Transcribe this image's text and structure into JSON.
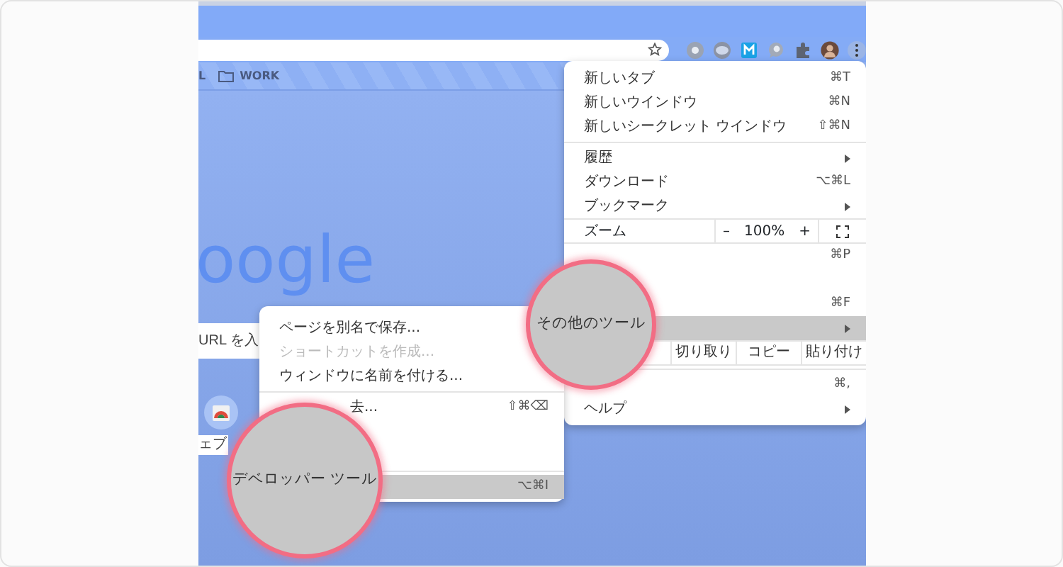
{
  "bookmarks": [
    {
      "label": "L",
      "kind": "link"
    },
    {
      "label": "WORK",
      "kind": "folder"
    }
  ],
  "new_tab_page": {
    "logo": "oogle",
    "search_text": "URL を入",
    "shortcut_label": "ェブ"
  },
  "main_menu": [
    {
      "kind": "item",
      "label": "新しいタブ",
      "shortcut": "⌘T",
      "submenu": false,
      "selected": false
    },
    {
      "kind": "item",
      "label": "新しいウインドウ",
      "shortcut": "⌘N",
      "submenu": false,
      "selected": false
    },
    {
      "kind": "item",
      "label": "新しいシークレット ウインドウ",
      "shortcut": "⇧⌘N",
      "submenu": false,
      "selected": false
    },
    {
      "kind": "divider"
    },
    {
      "kind": "item",
      "label": "履歴",
      "submenu": true,
      "selected": false
    },
    {
      "kind": "item",
      "label": "ダウンロード",
      "shortcut": "⌥⌘L",
      "submenu": false,
      "selected": false
    },
    {
      "kind": "item",
      "label": "ブックマーク",
      "submenu": true,
      "selected": false
    },
    {
      "kind": "zoom",
      "label": "ズーム",
      "minus": "–",
      "value": "100%",
      "plus": "+"
    },
    {
      "kind": "item",
      "shortcut": "⌘P",
      "submenu": false,
      "selected": false
    },
    {
      "kind": "item",
      "submenu": false,
      "selected": false
    },
    {
      "kind": "item",
      "shortcut": "⌘F",
      "submenu": false,
      "selected": false
    },
    {
      "kind": "item",
      "submenu": true,
      "selected": true
    },
    {
      "kind": "edit",
      "buttons": [
        "切り取り",
        "コピー",
        "貼り付け"
      ]
    },
    {
      "kind": "divider"
    },
    {
      "kind": "item",
      "shortcut": "⌘,",
      "submenu": false,
      "selected": false
    },
    {
      "kind": "item",
      "label": "ヘルプ",
      "submenu": true,
      "selected": false
    }
  ],
  "submenu": [
    {
      "kind": "item",
      "label": "ページを別名で保存...",
      "disabled": false,
      "selected": false
    },
    {
      "kind": "item",
      "label": "ショートカットを作成...",
      "disabled": true,
      "selected": false
    },
    {
      "kind": "item",
      "label": "ウィンドウに名前を付ける...",
      "disabled": false,
      "selected": false
    },
    {
      "kind": "divider"
    },
    {
      "kind": "partial",
      "label": "去...",
      "shortcut": "⇧⌘⌫",
      "disabled": false,
      "selected": false
    },
    {
      "kind": "item",
      "selected": false
    },
    {
      "kind": "item",
      "selected": false
    },
    {
      "kind": "divider"
    },
    {
      "kind": "item",
      "shortcut": "⌥⌘I",
      "disabled": false,
      "selected": true
    }
  ],
  "magnifiers": [
    {
      "text": "その他のツール"
    },
    {
      "text": "デベロッパー ツール"
    }
  ]
}
